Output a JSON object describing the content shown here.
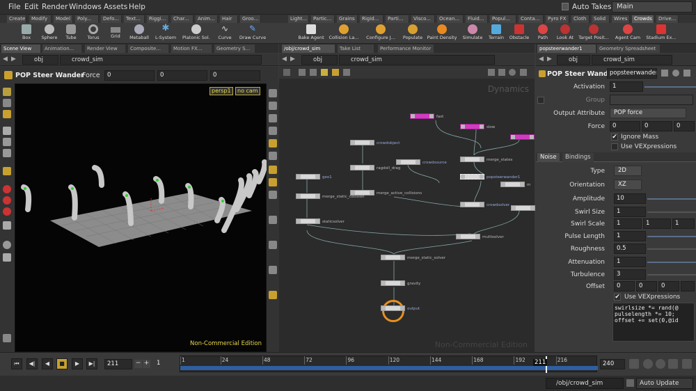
{
  "menu": [
    "File",
    "Edit",
    "Render",
    "Windows",
    "Assets",
    "Help"
  ],
  "menu_right": {
    "auto_takes": "Auto Takes",
    "desktop": "Main"
  },
  "shelf_tabs_left": [
    "Create",
    "Modify",
    "Model",
    "Poly...",
    "Defo...",
    "Text...",
    "Riggi...",
    "Char...",
    "Anim...",
    "Hair",
    "Groo..."
  ],
  "shelf_tabs_right": [
    "Light...",
    "Partic...",
    "Grains",
    "Rigid...",
    "Parti...",
    "Visco...",
    "Ocean...",
    "Fluid...",
    "Popul...",
    "Conta...",
    "Pyro FX",
    "Cloth",
    "Solid",
    "Wires",
    "Crowds",
    "Drive..."
  ],
  "tools_left": [
    "Box",
    "Sphere",
    "Tube",
    "Torus",
    "Grid",
    "Metaball",
    "L-System",
    "Platonic Sol...",
    "Curve",
    "Draw Curve"
  ],
  "tools_right": [
    "Bake Agent",
    "Collision La...",
    "Configure J...",
    "Populate",
    "Paint Density",
    "Simulate",
    "Terrain",
    "Obstacle",
    "Path",
    "Look At",
    "Target Posit...",
    "Agent Cam",
    "Stadium Ex..."
  ],
  "pane_tabs_left": [
    "Scene View",
    "Animation...",
    "Render View",
    "Composite...",
    "Motion FX...",
    "Geometry S..."
  ],
  "pane_tabs_mid": [
    "/obj/crowd_sim",
    "Take List",
    "Performance Monitor"
  ],
  "pane_tabs_right": [
    "popsteerwander1",
    "Geometry Spreadsheet"
  ],
  "path": {
    "left_obj": "obj",
    "left_net": "crowd_sim",
    "mid_obj": "obj",
    "mid_net": "crowd_sim",
    "right_obj": "obj",
    "right_net": "crowd_sim"
  },
  "viewport": {
    "op_title": "POP Steer Wander",
    "force_label": "Force",
    "force": [
      "0",
      "0",
      "0"
    ],
    "cam": "persp1",
    "view": "no cam",
    "watermark": "Non-Commercial Edition"
  },
  "network": {
    "context": "Dynamics",
    "watermark": "Non-Commercial Edition",
    "nodes": [
      "fast",
      "slow",
      "crowdobject",
      "crowdsource",
      "ragdoll_drag",
      "merge_states",
      "geo1",
      "popsteerwander1",
      "m",
      "merge_static_collision",
      "merge_active_collisions",
      "crowdsolver",
      "staticsolver",
      "multisolver",
      "merge_static_solver",
      "gravity",
      "output"
    ]
  },
  "params": {
    "op_title": "POP Steer Wand...",
    "node_name": "popsteerwander",
    "activation_label": "Activation",
    "activation": "1",
    "group_label": "Group",
    "output_attr_label": "Output Attribute",
    "output_attr": "POP force",
    "force_label": "Force",
    "force": [
      "0",
      "0",
      "0"
    ],
    "ignore_mass": "Ignore Mass",
    "use_vex_top": "Use VEXpressions",
    "tabs": [
      "Noise",
      "Bindings"
    ],
    "type_label": "Type",
    "type": "2D",
    "orient_label": "Orientation",
    "orient": "XZ",
    "amp_label": "Amplitude",
    "amp": "10",
    "swirlsize_label": "Swirl Size",
    "swirlsize": "1",
    "swirlscale_label": "Swirl Scale",
    "swirlscale": [
      "1",
      "1",
      "1"
    ],
    "pulse_label": "Pulse Length",
    "pulse": "1",
    "rough_label": "Roughness",
    "rough": "0.5",
    "atten_label": "Attenuation",
    "atten": "1",
    "turb_label": "Turbulence",
    "turb": "3",
    "offset_label": "Offset",
    "offset": [
      "0",
      "0",
      "0"
    ],
    "use_vex": "Use VEXpressions",
    "vex": [
      "swirlsize *= rand(@",
      "pulselength *= 10;",
      "offset += set(0,@id"
    ]
  },
  "timeline": {
    "frame": "211",
    "step": "1",
    "ticks": [
      "1",
      "24",
      "48",
      "72",
      "96",
      "120",
      "144",
      "168",
      "192",
      "216"
    ],
    "current_marker": "211",
    "end": "240",
    "current_fraction": 0.875
  },
  "status": {
    "path": "/obj/crowd_sim",
    "update": "Auto Update"
  }
}
